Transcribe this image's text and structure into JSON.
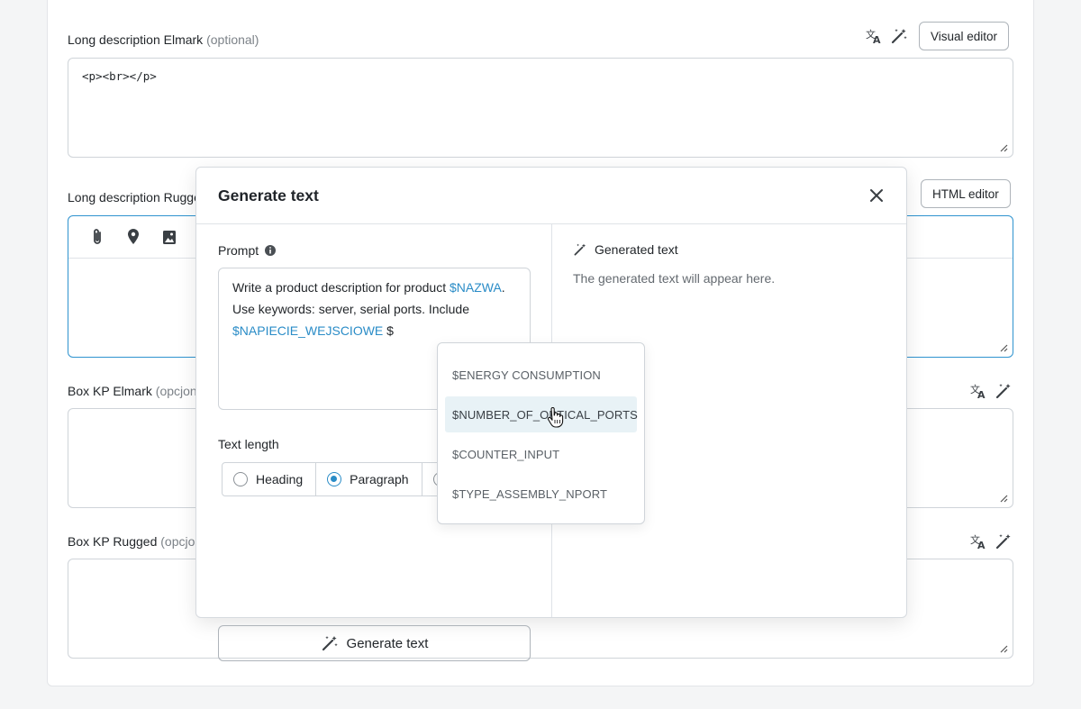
{
  "fields": {
    "long_elmark": {
      "label": "Long description Elmark",
      "optional": "(optional)",
      "value": "<p><br></p>",
      "editor_button": "Visual editor"
    },
    "long_rugged": {
      "label": "Long description Rugge",
      "editor_button": "HTML editor"
    },
    "box_elmark": {
      "label": "Box KP Elmark",
      "optional": "(opcjon"
    },
    "box_rugged": {
      "label": "Box KP Rugged",
      "optional": "(opcjon"
    }
  },
  "modal": {
    "title": "Generate text",
    "prompt_label": "Prompt",
    "prompt": {
      "part1": "Write a product description for product ",
      "var1": "$NAZWA",
      "part2": ". Use keywords: server, serial ports. Include ",
      "var2": "$NAPIECIE_WEJSCIOWE",
      "part3": " $"
    },
    "length_label": "Text length",
    "length_options": [
      {
        "label": "Heading",
        "selected": false
      },
      {
        "label": "Paragraph",
        "selected": true
      }
    ],
    "generate_button": "Generate text",
    "generated_heading": "Generated text",
    "generated_placeholder": "The generated text will appear here."
  },
  "dropdown": {
    "items": [
      {
        "label": "$ENERGY CONSUMPTION",
        "active": false
      },
      {
        "label": "$NUMBER_OF_OPTICAL_PORTS",
        "active": true
      },
      {
        "label": "$COUNTER_INPUT",
        "active": false
      },
      {
        "label": "$TYPE_ASSEMBLY_NPORT",
        "active": false
      }
    ]
  },
  "colors": {
    "accent": "#2a8cc7",
    "focus_border": "#2f93cf",
    "hover_bg": "#e8f2f6"
  }
}
